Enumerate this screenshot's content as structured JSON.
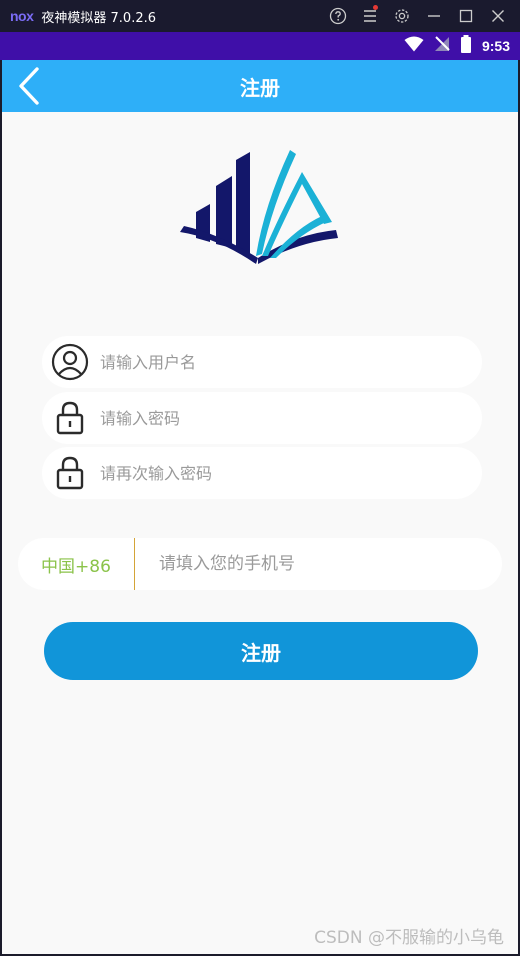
{
  "emulator": {
    "logo_text": "nox",
    "title": "夜神模拟器 7.0.2.6"
  },
  "status_bar": {
    "time": "9:53"
  },
  "header": {
    "title": "注册"
  },
  "form": {
    "username_placeholder": "请输入用户名",
    "password_placeholder": "请输入密码",
    "confirm_password_placeholder": "请再次输入密码",
    "country_code": "中国+86",
    "phone_placeholder": "请填入您的手机号",
    "submit_label": "注册"
  },
  "watermark": "CSDN @不服输的小乌龟",
  "colors": {
    "header_bg": "#2eaff8",
    "status_bar_bg": "#3f0fa8",
    "button_bg": "#1195d9",
    "country_code": "#8bc34a"
  }
}
